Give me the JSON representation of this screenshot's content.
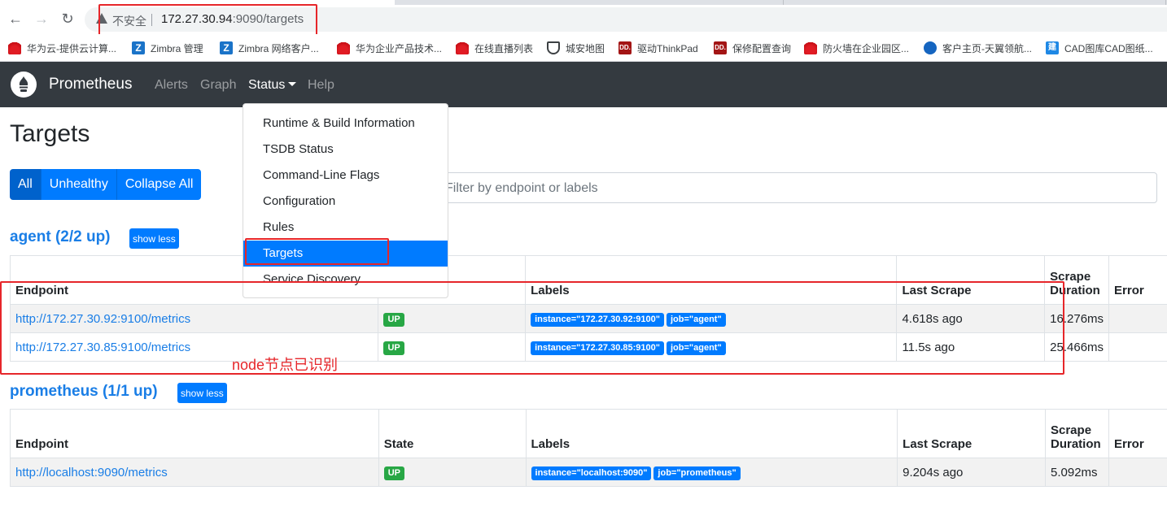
{
  "browser": {
    "insecure_label": "不安全",
    "url_host": "172.27.30.94",
    "url_path": ":9090/targets",
    "bookmarks": [
      {
        "label": "华为云-提供云计算...",
        "icon": "huawei-icon"
      },
      {
        "label": "Zimbra 管理",
        "icon": "zimbra-icon"
      },
      {
        "label": "Zimbra 网络客户...",
        "icon": "zimbra-icon"
      },
      {
        "label": "华为企业产品技术...",
        "icon": "huawei-icon"
      },
      {
        "label": "在线直播列表",
        "icon": "huawei-icon"
      },
      {
        "label": "城安地图",
        "icon": "shield-icon"
      },
      {
        "label": "驱动ThinkPad",
        "icon": "dd-icon"
      },
      {
        "label": "保修配置查询",
        "icon": "dd-icon"
      },
      {
        "label": "防火墙在企业园区...",
        "icon": "huawei-icon"
      },
      {
        "label": "客户主页-天翼领航...",
        "icon": "tianyi-icon"
      },
      {
        "label": "CAD图库CAD图纸...",
        "icon": "jian-icon"
      }
    ],
    "icon_glyphs": {
      "zimbra": "Z",
      "dd": "DD.",
      "jian": "建"
    }
  },
  "navbar": {
    "brand": "Prometheus",
    "links": [
      "Alerts",
      "Graph",
      "Status",
      "Help"
    ]
  },
  "status_menu": {
    "items": [
      "Runtime & Build Information",
      "TSDB Status",
      "Command-Line Flags",
      "Configuration",
      "Rules",
      "Targets",
      "Service Discovery"
    ],
    "active": "Targets"
  },
  "page": {
    "title": "Targets",
    "filter_buttons": [
      "All",
      "Unhealthy",
      "Collapse All"
    ],
    "filter_placeholder": "Filter by endpoint or labels"
  },
  "columns": {
    "endpoint": "Endpoint",
    "state": "State",
    "labels": "Labels",
    "last_scrape": "Last Scrape",
    "scrape_duration_1": "Scrape",
    "scrape_duration_2": "Duration",
    "error": "Error"
  },
  "jobs": [
    {
      "title": "agent (2/2 up)",
      "toggle": "show less",
      "targets": [
        {
          "endpoint": "http://172.27.30.92:9100/metrics",
          "state": "UP",
          "labels": [
            "instance=\"172.27.30.92:9100\"",
            "job=\"agent\""
          ],
          "last_scrape": "4.618s ago",
          "duration": "16.276ms",
          "error": ""
        },
        {
          "endpoint": "http://172.27.30.85:9100/metrics",
          "state": "UP",
          "labels": [
            "instance=\"172.27.30.85:9100\"",
            "job=\"agent\""
          ],
          "last_scrape": "11.5s ago",
          "duration": "25.466ms",
          "error": ""
        }
      ]
    },
    {
      "title": "prometheus (1/1 up)",
      "toggle": "show less",
      "targets": [
        {
          "endpoint": "http://localhost:9090/metrics",
          "state": "UP",
          "labels": [
            "instance=\"localhost:9090\"",
            "job=\"prometheus\""
          ],
          "last_scrape": "9.204s ago",
          "duration": "5.092ms",
          "error": ""
        }
      ]
    }
  ],
  "annotation": "node节点已识别",
  "colors": {
    "accent": "#007bff",
    "up": "#28a745",
    "navbar": "#343a40",
    "annotation": "#e6262a"
  }
}
